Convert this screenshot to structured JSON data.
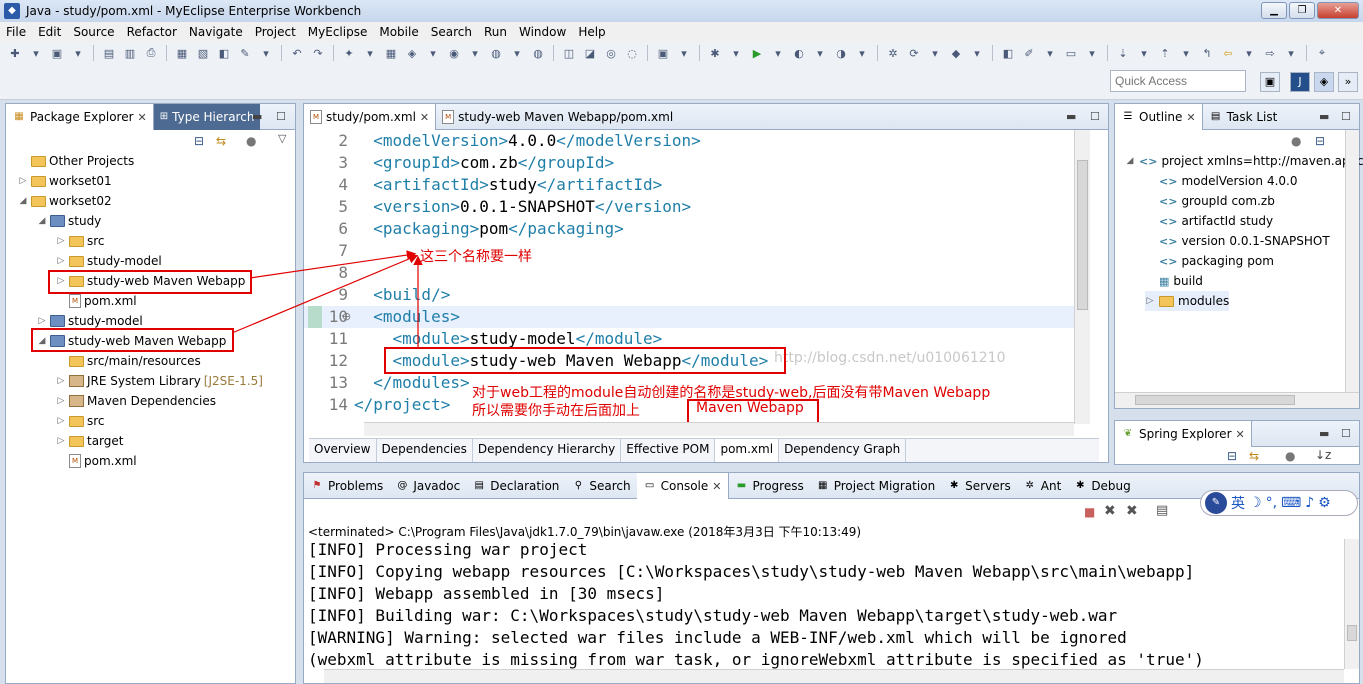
{
  "window": {
    "title": "Java - study/pom.xml - MyEclipse Enterprise Workbench"
  },
  "menu": [
    "File",
    "Edit",
    "Source",
    "Refactor",
    "Navigate",
    "Project",
    "MyEclipse",
    "Mobile",
    "Search",
    "Run",
    "Window",
    "Help"
  ],
  "quick_access": {
    "placeholder": "Quick Access"
  },
  "package_explorer": {
    "tabs": [
      {
        "label": "Package Explorer"
      },
      {
        "label": "Type Hierarch"
      }
    ],
    "items": [
      {
        "label": "Other Projects"
      },
      {
        "label": "workset01"
      },
      {
        "label": "workset02"
      },
      {
        "label": "study"
      },
      {
        "label": "src"
      },
      {
        "label": "study-model"
      },
      {
        "label": "study-web Maven Webapp"
      },
      {
        "label": "pom.xml"
      },
      {
        "label": "study-model"
      },
      {
        "label": "study-web Maven Webapp"
      },
      {
        "label": "src/main/resources"
      },
      {
        "label": "JRE System Library",
        "extra": "[J2SE-1.5]"
      },
      {
        "label": "Maven Dependencies"
      },
      {
        "label": "src"
      },
      {
        "label": "target"
      },
      {
        "label": "pom.xml"
      }
    ]
  },
  "editor": {
    "tabs": [
      {
        "label": "study/pom.xml"
      },
      {
        "label": "study-web Maven Webapp/pom.xml"
      }
    ],
    "lines": [
      {
        "n": "2",
        "indent": "  ",
        "open": "<modelVersion>",
        "text": "4.0.0",
        "close": "</modelVersion>"
      },
      {
        "n": "3",
        "indent": "  ",
        "open": "<groupId>",
        "text": "com.zb",
        "close": "</groupId>"
      },
      {
        "n": "4",
        "indent": "  ",
        "open": "<artifactId>",
        "text": "study",
        "close": "</artifactId>"
      },
      {
        "n": "5",
        "indent": "  ",
        "open": "<version>",
        "text": "0.0.1-SNAPSHOT",
        "close": "</version>"
      },
      {
        "n": "6",
        "indent": "  ",
        "open": "<packaging>",
        "text": "pom",
        "close": "</packaging>"
      },
      {
        "n": "7",
        "indent": "",
        "open": "",
        "text": "",
        "close": ""
      },
      {
        "n": "8",
        "indent": "",
        "open": "",
        "text": "",
        "close": ""
      },
      {
        "n": "9",
        "indent": "  ",
        "open": "<build/>",
        "text": "",
        "close": ""
      },
      {
        "n": "10",
        "indent": "  ",
        "open": "<modules>",
        "text": "",
        "close": ""
      },
      {
        "n": "11",
        "indent": "    ",
        "open": "<module>",
        "text": "study-model",
        "close": "</module>"
      },
      {
        "n": "12",
        "indent": "    ",
        "open": "<module>",
        "text": "study-web Maven Webapp",
        "close": "</module>"
      },
      {
        "n": "13",
        "indent": "  ",
        "open": "</modules>",
        "text": "",
        "close": ""
      },
      {
        "n": "14",
        "indent": "",
        "open": "</project>",
        "text": "",
        "close": ""
      }
    ],
    "bottom_tabs": [
      "Overview",
      "Dependencies",
      "Dependency Hierarchy",
      "Effective POM",
      "pom.xml",
      "Dependency Graph"
    ],
    "watermark": "http://blog.csdn.net/u010061210"
  },
  "annotations": {
    "same_names": "这三个名称要一样",
    "explain_line1": "对于web工程的module自动创建的名称是study-web,后面没有带Maven Webapp",
    "explain_line2": "所以需要你手动在后面加上",
    "maven_webapp": "Maven Webapp"
  },
  "outline": {
    "tabs": [
      {
        "label": "Outline"
      },
      {
        "label": "Task List"
      }
    ],
    "items": [
      {
        "label": "project xmlns=http://maven.apach"
      },
      {
        "label": "modelVersion",
        "value": "4.0.0"
      },
      {
        "label": "groupId",
        "value": "com.zb"
      },
      {
        "label": "artifactId",
        "value": "study"
      },
      {
        "label": "version",
        "value": "0.0.1-SNAPSHOT"
      },
      {
        "label": "packaging",
        "value": "pom"
      },
      {
        "label": "build"
      },
      {
        "label": "modules"
      }
    ]
  },
  "spring_explorer": {
    "label": "Spring Explorer"
  },
  "console": {
    "tabs": [
      "Problems",
      "Javadoc",
      "Declaration",
      "Search",
      "Console",
      "Progress",
      "Project Migration",
      "Servers",
      "Ant",
      "Debug"
    ],
    "status": "<terminated> C:\\Program Files\\Java\\jdk1.7.0_79\\bin\\javaw.exe (2018年3月3日 下午10:13:49)",
    "lines": [
      "[INFO] Processing war project",
      "[INFO] Copying webapp resources [C:\\Workspaces\\study\\study-web Maven Webapp\\src\\main\\webapp]",
      "[INFO] Webapp assembled in [30 msecs]",
      "[INFO] Building war: C:\\Workspaces\\study\\study-web Maven Webapp\\target\\study-web.war",
      "[WARNING] Warning: selected war files include a WEB-INF/web.xml which will be ignored",
      "(webxml attribute is missing from war task, or ignoreWebxml attribute is specified as 'true')"
    ]
  },
  "ime": {
    "lang": "英"
  }
}
